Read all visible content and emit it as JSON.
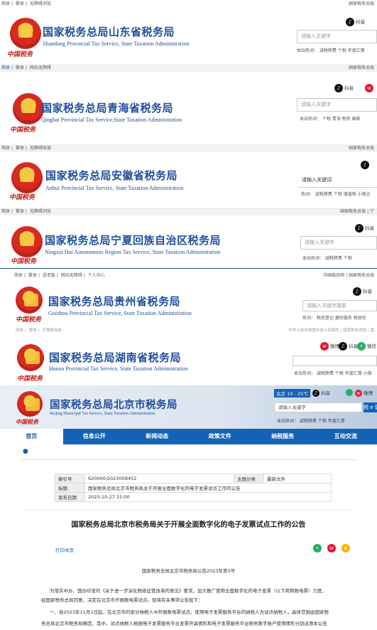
{
  "shandong": {
    "topbar": [
      "简体",
      "繁体",
      "无障碍浏览"
    ],
    "topright": "国家税务总局",
    "title": "国家税务总局山东省税务局",
    "subtitle": "Shandong Provincial Tax Service, State Taxation Administration",
    "mark": "中国税务",
    "douyin": "抖音",
    "search_placeholder": "请输入关键字",
    "hot": "本站热词：  减税降费  个税  年度汇算"
  },
  "qinghai": {
    "topbar": [
      "简体",
      "繁体",
      "网站无障碍"
    ],
    "topright": "国家税务总局",
    "title": "国家税务总局青海省税务局",
    "subtitle": "Qinghai Provincial Tax Service,State Taxation Administration",
    "mark": "中国税务",
    "douyin": "抖音",
    "search_placeholder": "请输入关键字",
    "hot": "本站热词：  个税  青海  税务  国家"
  },
  "anhui": {
    "topbar": [
      "简体",
      "繁体",
      "无障碍阅读"
    ],
    "topright": "国家税务总局",
    "title": "国家税务总局安徽省税务局",
    "subtitle": "Anhui Provincial Tax Service, State Taxation Administration",
    "mark": "中国税务",
    "douyin": "抖音",
    "search_placeholder": "请输入关键词",
    "hot": "热词：  减税降费  个税  增值税  小微企"
  },
  "ningxia": {
    "topbar": [
      "简体",
      "繁体",
      "无障碍浏览"
    ],
    "topright": "国家税务总局  |  宁",
    "title": "国家税务总局宁夏回族自治区税务局",
    "subtitle": "Ningxia Hui Autonomous Region Tax Service, State Taxation Administration",
    "mark": "中国税务",
    "douyin": "抖音",
    "search_placeholder": "请输入关键字",
    "hot": "本站热词：  减税降费  个税"
  },
  "guizhou": {
    "topbar": [
      "简体",
      "繁体",
      "适老版",
      "网站无障碍",
      "个人中心"
    ],
    "topright": "中国政府网  |  国家税务总局",
    "title": "国家税务总局贵州省税务局",
    "subtitle": "Guizhou Provincial Tax Service, State Taxation Administration",
    "mark": "中国税务",
    "douyin": "抖音",
    "search_placeholder": "请输入关键字搜索",
    "hot": "热词：  税务登记  便民服务  税收优"
  },
  "hunan": {
    "topbar": [
      "简体",
      "繁体",
      "无障碍阅读"
    ],
    "topright": "中华人民共和国中央人民政府  |  国家税务总局  |  国",
    "title": "国家税务总局湖南省税务局",
    "subtitle": "Hunan Provincial Tax Service,  State Taxation Administration",
    "mark": "中国税务",
    "weibo": "微博",
    "douyin": "抖音",
    "wechat": "微信",
    "hot": "本站热词：  减税降费  个税  年度汇算  小微"
  },
  "beijing": {
    "title": "国家税务总局北京市税务局",
    "subtitle": "Beijing Municipal Tax Service, State Taxation Administration",
    "mark": "中国税务",
    "weather": "北京  10 - 25℃",
    "douyin": "抖音",
    "weibo": "微博",
    "search_placeholder": "请输入关键字",
    "hot": "本站热词：  减税降费  个税  年度汇算",
    "btn": "税 e 营"
  },
  "nav": [
    "首页",
    "信息公开",
    "新闻动态",
    "政策文件",
    "纳税服务",
    "互动交流"
  ],
  "meta": {
    "rows": [
      [
        "索引号",
        "620000/2023008452",
        "主题分类",
        "最新文件"
      ],
      [
        "标题",
        "国家税务总局北京市税务局关于开展全面数字化的电子发票试点工作的公告"
      ],
      [
        "发布日期",
        "2023-10-27 15:00"
      ]
    ]
  },
  "article": {
    "title": "国家税务总局北京市税务局关于开展全面数字化的电子发票试点工作的公告",
    "print": "打印本页",
    "number": "国家税务总局北京市税务局公告2023年第3号",
    "p1": "为落实中办、国办印发的《关于进一步深化税收征管改革的意见》要求，加大推广使用全面数字化的电子发票（以下简称数电票）力度，",
    "p2": "经国家税务总局同意，决定在北京市开展数电票试点。现将有关事项公告如下：",
    "p3": "一、自2023年11月1日起，在北京市的部分纳税人中开展数电票试点。使用电子发票服务平台的纳税人为试点纳税人，具体范围由国家税",
    "p4": "务总局北京市税务局确定。其中，试点纳税人根据电子发票服务平台发票开具情形和电子发票服务平台税务数字账户使用情形分别适用本公告"
  }
}
